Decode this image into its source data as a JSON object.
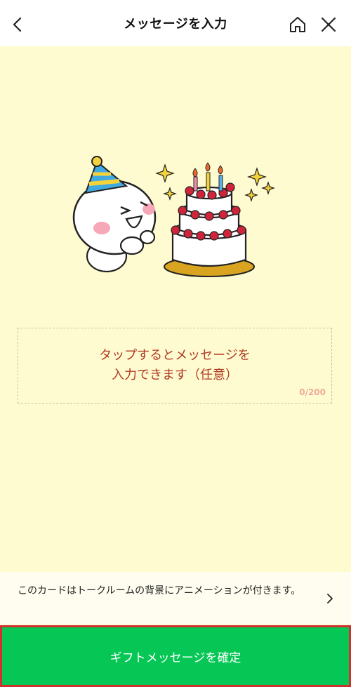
{
  "header": {
    "title": "メッセージを入力",
    "back_icon": "chevron-left-icon",
    "home_icon": "home-icon",
    "close_icon": "close-icon"
  },
  "illustration": {
    "description_icon": "birthday-cake-sticker"
  },
  "message_input": {
    "placeholder": "タップするとメッセージを\n入力できます（任意）",
    "char_count": "0/200"
  },
  "notice": {
    "text": "このカードはトークルームの背景にアニメーションが付きます。",
    "chevron_icon": "chevron-right-icon"
  },
  "confirm_button": {
    "label": "ギフトメッセージを確定"
  },
  "colors": {
    "background": "#fffbd0",
    "accent_green": "#06c755",
    "placeholder_red": "#b03a24",
    "highlight_border": "#d22f2f"
  }
}
